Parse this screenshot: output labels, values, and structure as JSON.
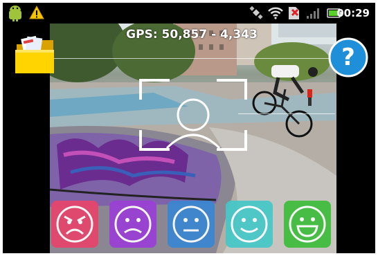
{
  "status_bar": {
    "time": "00:29",
    "icons": [
      "android-bugdroid-icon",
      "warning-icon",
      "gps-satellite-icon",
      "wifi-icon",
      "no-sim-icon",
      "signal-icon",
      "battery-icon"
    ]
  },
  "camera": {
    "gps_text": "GPS: 50,857 - 4,343"
  },
  "buttons": {
    "folder_icon": "folder-icon",
    "help_symbol": "?"
  },
  "mood_buttons": [
    {
      "name": "angry-face-button",
      "color": "#e8446c"
    },
    {
      "name": "sad-face-button",
      "color": "#9b3fd6"
    },
    {
      "name": "neutral-face-button",
      "color": "#3a86d2"
    },
    {
      "name": "smile-face-button",
      "color": "#45c8c8"
    },
    {
      "name": "happy-face-button",
      "color": "#3ebd3b"
    }
  ]
}
